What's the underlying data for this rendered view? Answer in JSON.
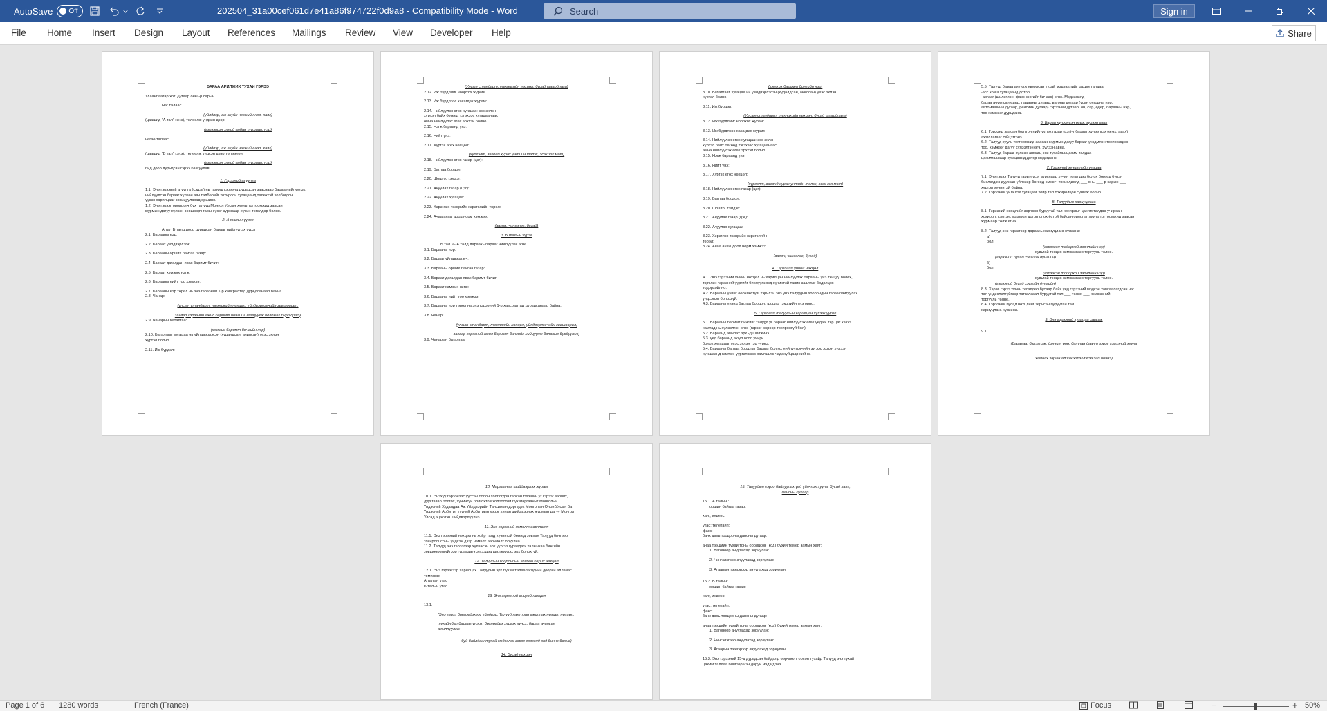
{
  "titlebar": {
    "autosave_label": "AutoSave",
    "autosave_state": "Off",
    "document_title": "202504_31a00cef061d7e41a86f974722f0d9a8  -  Compatibility Mode  -  Word",
    "search_placeholder": "Search",
    "signin_label": "Sign in",
    "icons": [
      "save-icon",
      "undo-icon",
      "redo-icon",
      "customize-qat-icon",
      "ribbon-display-icon",
      "minimize-icon",
      "maximize-icon",
      "close-icon"
    ]
  },
  "ribbon": {
    "tabs": [
      "File",
      "Home",
      "Insert",
      "Design",
      "Layout",
      "References",
      "Mailings",
      "Review",
      "View",
      "Developer",
      "Help"
    ],
    "share_label": "Share"
  },
  "pages": [
    {
      "lines": [
        "БАРАА АРИЛЖИХ ТУХАЙ ГЭРЭЭ",
        "Улаанбаатар хот.                    Дугаар                  оны      -р сарын",
        "Нэг талаас",
        "(үйлдвэр, аж ахуйн нэгжийн нэр, хаяг)",
        "(цаашид \"А тал\" гэнэ), төлөөлж                          үндсэн дээр",
        "(гэрээлсэн хүний албан тушаал, нэр)",
        "нөгөө талаас",
        "(үйлдвэр, аж ахуйн нэгжийн нэр, хаяг)",
        "(цаашид \"Б тал\" гэнэ), төлөөлж                 үндсэн дээр төлөөлөн",
        "(гэрээлсэн хүний албан тушаал, нэр)",
        "бид доор дурьдсан гэрээ байгуулав.",
        "1. Гэрээний агуулга",
        "1.1. Энэ гэрээний агуулга (сэдэв) нь талууд гэрээнд дурьдсан зааснаар бараа нийлүүлэх,",
        "нийлүүлсэн барааг хүлээн авч төлбөрийг тохирсон хугацаанд төлөхтэй холбогдон",
        "үүсэх харилцааг зохицуулахад оршино.",
        "1.2. Энэ гэрээг оролцогч бүх талууд Монгол Улсын хууль тогтоомжид заасан",
        "журмын дагуу хүлээн зөвшөөрч гарын үсэг зурснаар хүчин төгөлдөр болно.",
        "2. А талын үүрэг",
        "А тал Б талд доор дурьдсан барааг нийлүүлэх үүрэг",
        "2.1. Барааны нэр:",
        "2.2. Бараат үйлдвэрлэгч:",
        "2.3. Барааны орших байгаа газар:",
        "2.4. Бараат дагалдан явах баримт бичиг:",
        "2.5. Бараат хэмжих нэгж:",
        "2.6. Барааны нийт тоо хэмжээ:",
        "2.7. Барааны нэр төрөл нь энэ гэрээний 1-р хавсралтад дурьдсанаар байна.",
        "2.8. Чанар:",
        "(улсын стандарт, техникийн нөхцөл, үйлдвэрлэгчийн зөвшөөрөл,",
        "загвар гэрээний ажил баримт бичгийг нийцүүлж болохыг бүрдүүлнэ)",
        "2.9. Чанарын баталгаа:",
        "(хэмжих баримт бичгийн нэр)",
        "2.10. Баталгаат хугацаа нь үйлдвэрлэсэн (худалдсан, ачилсан) үеэс эхлэн",
        "                                                      хүртэл болно.",
        "2.11. Иж бүрдэл:"
      ]
    },
    {
      "lines": [
        "(Улсын стандарт, техникийн нөхцөл, бусад шаардлага)",
        "2.12. Иж бүрдлийг ноорхох журам:",
        "2.13. Иж бүрдлээс хасагдах журам:",
        "2.14. Нийлүүлэх өгөх хугацаа:                                        эсс эхлэн",
        "                              хүртэл байх бөгөөд тэгэхээс хугацаанаас",
        "өмнө нийлүүлэх өгөх эрхтэй болно.",
        "2.15. Нэгж бараанд үнэ:",
        "2.16. Нийт үнэ:",
        "2.17. Хүргэх өгөх нөхцөл:",
        "(хүргэлт, вагонд хурах унтийн тэлэх, эсэх зэх мөт)",
        "2.18. Нийлүүлэх өгөх газар (цэг):",
        "2.19. Баглаа боодол:",
        "2.20. Шошго, тэмдэг:",
        "2.21. Ачуулах газар (цэг):",
        "2.22. Ачуулах хугацаа:",
        "2.23. Хэрэглэх тээврийн хэрэгслийн төрөл:",
        "2.24. Ачаа анхы доод норм хэмжээ:",
        "(вагон, чингэлэг, бусад)",
        "3. Б талын үүрэг",
        "Б тал нь А талд дараахь барааг нийлүүлэх өгнө.",
        "3.1. Барааны нэр:",
        "3.2. Бараат үйлдвэрлэгч:",
        "3.3. Барааны орших байгаа газар:",
        "3.4. Бараат дагалдан явах баримт бичиг:",
        "3.5. Бараат хэмжих нэгж:",
        "3.6. Барааны нийт тоо хэмжээ:",
        "3.7. Барааны нэр төрөл нь энэ гэрээний 1-р хавсралтад дурьдсанаар байна.",
        "3.8. Чанар:",
        "(улсын стандарт, техникийн нөхцөл, үйлдвэрлэгчийн зөвшөөрөл,",
        "загвар гэрээний ажил баримт бичгийг нийцүүлж болохыг бүрдүүлнэ)",
        "3.9. Чанарын баталгаа:"
      ]
    },
    {
      "lines": [
        "(хэмжих баримт бичгийн нэр)",
        "3.10. Баталгаат хугацаа нь үйлдвэрлэсэн (худалдсан, ачилсан) үеэс эхлэн",
        "                                         хүртэл болно.",
        "3.11. Иж бүрдэл:",
        "(Улсын стандарт, техникийн нөхцөл, бусад шаардлага)",
        "3.12. Иж бүрдлийг ноорхох журам:",
        "3.13. Иж бүрдлээс хасагдах журам:",
        "3.14. Нийлүүлэх өгөх хугацаа:                                  эсс эхлэн",
        "                          хүртэл байх бөгөөд тэгэхээс хугацаанаас",
        "өмнө нийлүүлэх өгөх эрхтэй болно.",
        "3.15. Нэгж бараанд үнэ:",
        "3.16. Нийт үнэ:",
        "3.17. Хүргэх өгөх нөхцөл:",
        "(хүргэлт, вагонд хурах унтийн тэлэх, эсэх зэх мөт)",
        "3.18. Нийлүүлэх өгөх газар (цэг):",
        "3.19. Баглаа боодол:",
        "3.20. Шошго, тэмдэг:",
        "3.21. Ачуулах газар (цэг):",
        "3.22. Ачуулах хугацаа:",
        "3.23. Хэрэглэх тээврийн хэрэгслийн",
        "төрөл:",
        "3.24. Ачаа анхы доод норм хэмжээ:",
        "(вагон, чингэлэг, бусад)",
        "4. Гэрээний үнийн нөхцөл",
        "4.1. Энэ гэрээний үнийн нөхцөл нь харилцан нийлүүлэх барааны үнэ тэнцүү болох,",
        "тэрчлэн гэрээний үүргийг биелүүлэхэд хүчинтэй тавих заалтыг бодолцох",
        "тодорхойлно.",
        "4.2. Барааны үнийг өөрчлөхгүй, тэрчлэн энэ үнэ талуудын хоорондын гэрээ байгуулах",
        "үндсэлэл болохгүй.",
        "4.3. Барааны үнэнд баглаа боодол, шошго тэмдгийн үнэ орно.",
        "5. Гэрээний талуудын харилцан хүлээх үүрэг",
        "5.1. Барааны баримт бичгийг талууд уг барааг нийлүүлэх өгөх үедээ, тэр цаг хэзээ",
        "хамтад нь хүлээлгэн өгнө (гэрээг өөрөөр тохироогүй бол).",
        "5.2. Бараанд өмчлөх эрх                                      -д шилжинэ.",
        "5.3.                                                 үед бараанд аюул осол учирч",
        "болох хугацааг                             үеэс эхлэн тэр үүрнэ.",
        "5.4. Барааны баглаа боодлыг бараат болгох нийлүүлэгчийн зүгээс эхлэн хүлээн",
        "хугацаанд гэмтэх, үүргэлжээс хамгаалж чадахуйцаар хийнэ."
      ]
    },
    {
      "lines": [
        "5.5. Талууд бараа ачуулж явуулсан тухай мэдээллийг цахим талдаа",
        "                      -эсс хойш                       хугацаанд дотор",
        "                                  -аргааг (шилэглэн, факс зэргийг бичээс) өгнө. Мэдээлэлд",
        "бараа ачуулсан өдөр, падааны дугаар, вагоны дугаар (усан онгоцны нэр,",
        "автомашины дугаар, рейсийн дугаар) гэрээний дугаар, он, сар, өдөр, барааны нэр,",
        "тоо хэмжээг дурьдана.",
        "6. Бараа хүлээлгэн өгөх, хүлээн авах",
        "6.1. Гэрээнд заасан болтгон нийлүүлэх газар (цэг)-т барааг хүлээлгэх (өгөх, авах)",
        "ажиллагааг гүйцэтгэнэ.",
        "6.2. Талууд хууль тогтоомжид заасан журмын дагуу барааг үнэдмлэн тохиролцсон",
        "тоо, хэмжээг дагуу хүлээлгэн өгч, хүлээн авна.",
        "6.3. Талууд барааг хүлээн авмагц энэ тухайгаа цахим талдаа",
        "                 цахилгаанаар                      хугацаанд дотор мэдэгдэнэ.",
        "7. Гэрээний хүчинтэй хугацаа",
        "7.1. Энэ гэрээ Талууд гарын үсэг зурснаар хүчин төгөлдөр болох бөгөөд бүрэн",
        "биелэгдэж дууссан үйлсээр бөгөөд өмнө ч тохиолдолд ___ оны ___-р сарын ___",
        "хүртэл хүчинтэй байна.",
        "7.2. Гэрээний үйлчлэх хугацааг хойр тал тохиролцон сунгаж болно.",
        "8. Талуудын хариуцлага",
        "8.1. Гэрээний нөхцлийг зөрчсөн буруутай тал хохирлыг цахим талдаа учирсан",
        "хохирол, гэмтэл, хохирол дотор олох ёстой байсан орлогыг хууль тогтоомжид заасан",
        "журмаар төлж өгнө.",
        "8.2. Талууд энэ гэрээгээр дараахь хариуцлага хүлээнэ:",
        "а)",
        "бол",
        "(гэрээсэн тодорхой зөрчлийн нэр)",
        "хувьтай тэнцэх хэмжээгээр торгууль төлнө.",
        "(гэрээний бусад хэсгийн дүнгийн)",
        "б)",
        "бол",
        "(гэрээсэн тодорхой зөрчлийн нэр)",
        "хувьтай тэнцэх хэмжээгээр торгууль төлнө.",
        "(гэрээний бусад хэсгийн дүнгийн)",
        "8.3. Хэрэв гэрээ хүчин төгөлдөр бусаар байх үед гэрээний мэдсэн хамгаалагдсан нэг",
        "тал үндэслэлгүйгээр татгалзаал буруутай тал ___ төлөх ___ хэмжээний",
        "торгууль төлнө.",
        "8.4. Гэрээний бусад нөхцлийг зөрчсөн буруутай тал",
        "                                                    хариуцлага хүлээнэ.",
        "9. Энэ гэрээний хугацаа хавсаж",
        "9.1.",
        "(Барагаа, бэлэглэж, дэнчин, өнө, батлан даалт зэрэг гэрээний хууль",
        "хамаах зарын алийн хэрэглэхээ энд бичнэ)"
      ]
    },
    {
      "lines": [
        "10. Маргааныг шийдвэрлэх журам",
        "10.1. Энэхүү гэрээнээс үүссэн болон холбогдон гарсан түүнийн уг гэрээг зөрчих,",
        "дуусгавар болгох, хүчингүй болгохтой холбоотой бүх маргааныг Монголын",
        "Үндэсний Худалдаа Аж Үйлдвэрийн Танхимын дэргэдэх Монголын Олон Улсын ба",
        "Үндэсний Арбитрт түүний Арбитрын хэрэг хянан шийдвэрлэх журмын дагуу Монгол",
        "Улсад эцэслэн шийдвэрлүүлнэ.",
        "11. Энэ гэрээний нэмэлт өөрчлөлт",
        "11.1. Энэ гэрээний нөхцөл нь хойр талд хүчинтэй бөгөөд зөвхөн Талууд бичгээр",
        "тохиролцсоны үндсэн дээр нэмэлт өөрчлөлт оруулна.",
        "11.2. Талууд энэ гэрээгээр хүлээсэн эрх үүргээ гуравдагч талынхаа бичгийн",
        "зөвшөөрөлгүйгээр гуравдагч этгээдэд шилжүүлэх эрх болохгүй.",
        "12. Талуудын хоорондын холбоо барих нөхцөл",
        "12.1. Энэ гэрээгээр харилцах Талуудын эрх бүхий төлөөлөгчдийн доорхи аллаиас",
        "томилов:",
        "А талын                                              утас",
        "Б талын                                              утас",
        "13. Энэ гэрээний онцгой нөхцөл",
        "13.1.",
        "(Энэ гэрээ биелэгдэхээс үйлдвэр. Талууд хамтран ажиллах нөхцөл нөхцөл,",
        "тухайлбал барааг үнэрх, бөглөгдөх хүргэх хүнсх, бараа ачилсан",
        "ажиллуулга:",
        "буй байлдын тухай мэдээлэх зэрэг гэрээнд энд бичнэ болно)",
        "14. Бусад нөхцөл"
      ]
    },
    {
      "lines": [
        "15. Талуудын гэрээ байгуулах үед үйлчлэх хууль, бусад хаяг,",
        "дансны дугаар",
        "15.1. А талын :",
        "оршин байгаа газар:",
        "хаяг, индекс:",
        "утас:                       телетайп:",
        "факс:",
        "банк дахь тооцооны дансны дугаар:",
        "ачаа тээшийн тухай тоны оролцсон (код) бүхий төмөр замын хаяг:",
        "1. Вагоноор ачуулахад зориулан:",
        "2. Чингэлэгээр ачуулахад зориулан:",
        "3. Агаарын тээвэрээр ачуулахад зориулан:",
        "15.2. Б талын:",
        "оршин байгаа газар:",
        "хаяг, индекс:",
        "утас:                       телетайп:",
        "факс:",
        "банк дахь тооцооны дансны дугаар:",
        "ачаа тээшийн тухай тоны оролцсон (код) бүхий төмөр замын хаяг:",
        "1. Вагоноор ачуулахад зориулан:",
        "2. Чингэлэгээр ачуулахад зориулан:",
        "3. Агаарын тээвэрээр ачуулахад зориулан:",
        "15.3. Энэ гэрээний 15-д дурьдсан байдалд өөрчлөлт орсон тухайд Талууд энэ тухай",
        "цахим талдаа бичгээр нэн даруй мэдэгдэнэ."
      ]
    }
  ],
  "statusbar": {
    "page_info": "Page 1 of 6",
    "word_count": "1280 words",
    "language": "French (France)",
    "focus_label": "Focus",
    "zoom_level": "50%"
  }
}
